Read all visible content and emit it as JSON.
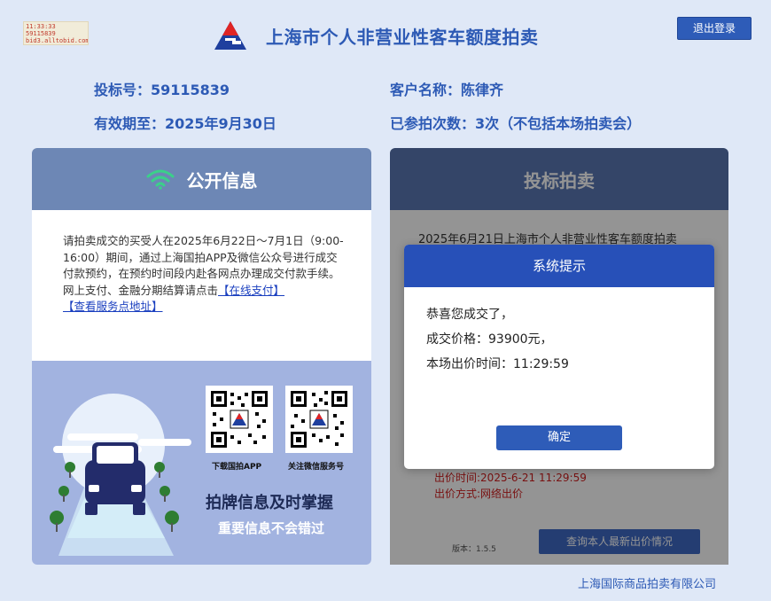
{
  "debug": {
    "line1": "11:33:33",
    "line2": "59115839",
    "line3": "bid3.alltobid.com"
  },
  "header": {
    "title": "上海市个人非营业性客车额度拍卖",
    "logout_label": "退出登录"
  },
  "info": {
    "bid_number": "投标号：59115839",
    "customer_name": "客户名称：陈律齐",
    "valid_until": "有效期至：2025年9月30日",
    "auction_count": "已参拍次数：3次（不包括本场拍卖会）"
  },
  "left_panel": {
    "title": "公开信息",
    "notice": "请拍卖成交的买受人在2025年6月22日～7月1日（9:00-16:00）期间，通过上海国拍APP及微信公众号进行成交付款预约，在预约时间段内赴各网点办理成交付款手续。",
    "online_prefix": "网上支付、金融分期结算请点击",
    "online_pay_link": "【在线支付】",
    "service_link": "【查看服务点地址】",
    "qr_app_caption": "下载国拍APP",
    "qr_wechat_caption": "关注微信服务号",
    "slogan_main": "拍牌信息及时掌握",
    "slogan_sub": "重要信息不会错过"
  },
  "right_panel": {
    "title": "投标拍卖",
    "auction_text": "2025年6月21日上海市个人非营业性客车额度拍卖",
    "bid_time": "出价时间:2025-6-21 11:29:59",
    "bid_way": "出价方式:网络出价",
    "version": "版本：1.5.5",
    "query_button": "查询本人最新出价情况"
  },
  "modal": {
    "title": "系统提示",
    "line1": "恭喜您成交了，",
    "line2": "成交价格：93900元，",
    "line3": "本场出价时间：11:29:59",
    "ok_label": "确定"
  },
  "footer": {
    "company": "上海国际商品拍卖有限公司"
  },
  "colors": {
    "brand_blue": "#2d5ab5",
    "button_blue": "#2e5cb8",
    "background": "#dfe8f7",
    "alert_red": "#d02020"
  }
}
